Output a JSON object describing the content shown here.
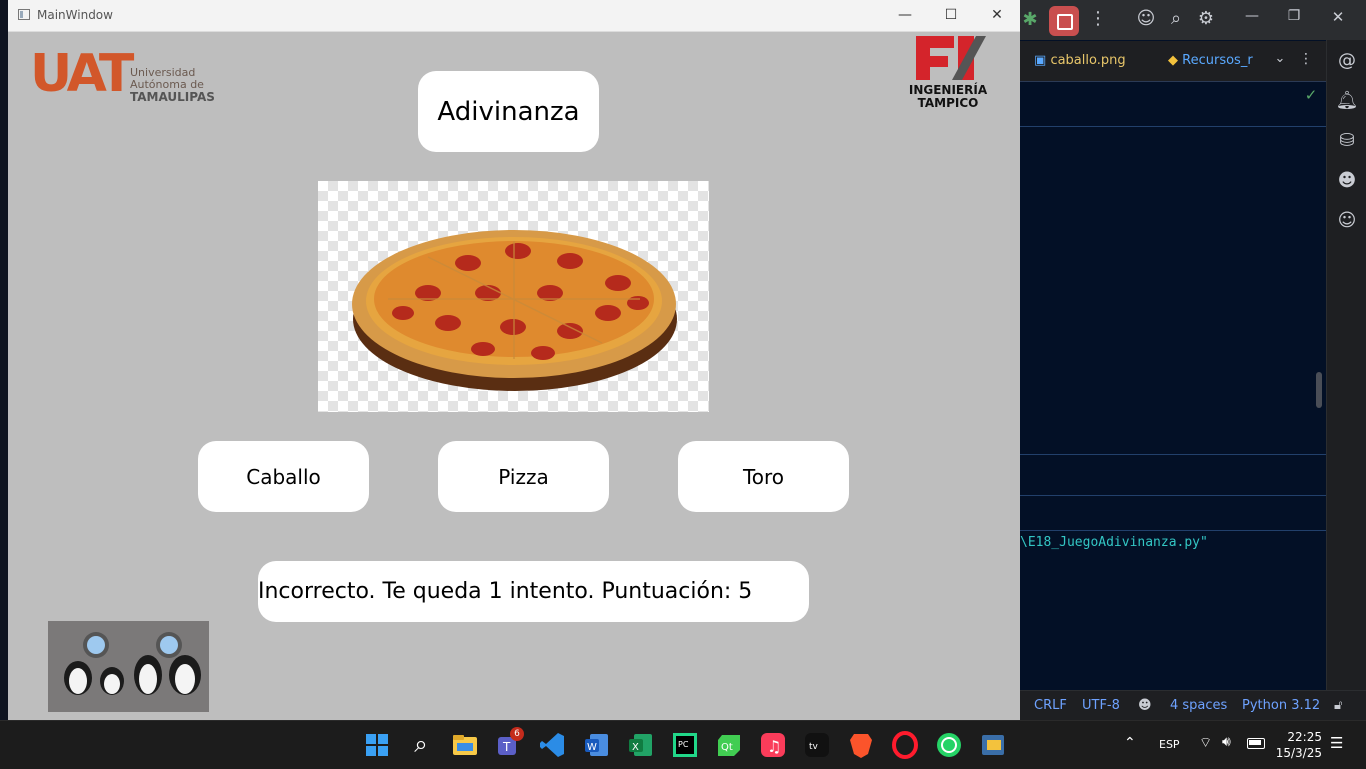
{
  "window": {
    "title": "MainWindow",
    "minimize_glyph": "—",
    "maximize_glyph": "☐",
    "close_glyph": "✕"
  },
  "logos": {
    "uat_letters": "UAT",
    "uat_line1": "Universidad",
    "uat_line2": "Autónoma de",
    "uat_line3": "TAMAULIPAS",
    "fi_line1": "INGENIERÍA",
    "fi_line2": "TAMPICO"
  },
  "game": {
    "title": "Adivinanza",
    "options": [
      "Caballo",
      "Pizza",
      "Toro"
    ],
    "message": "Incorrecto. Te queda 1 intento. Puntuación: 5"
  },
  "ide": {
    "tabs": [
      {
        "label": "caballo.png"
      },
      {
        "label": "Recursos_r"
      }
    ],
    "console_path": "\\E18_JuegoAdivinanza.py\"",
    "status": {
      "line_ending": "CRLF",
      "encoding": "UTF-8",
      "indent": "4 spaces",
      "interpreter": "Python 3.12"
    }
  },
  "taskbar": {
    "teams_badge": "6",
    "language": "ESP",
    "time": "22:25",
    "date": "15/3/25"
  },
  "colors": {
    "window_bg": "#bebebe",
    "card_bg": "#ffffff",
    "uat_orange": "#d2572a",
    "fi_red": "#d4242b",
    "ide_bg": "#031026",
    "taskbar_bg": "#1c1c1c"
  }
}
